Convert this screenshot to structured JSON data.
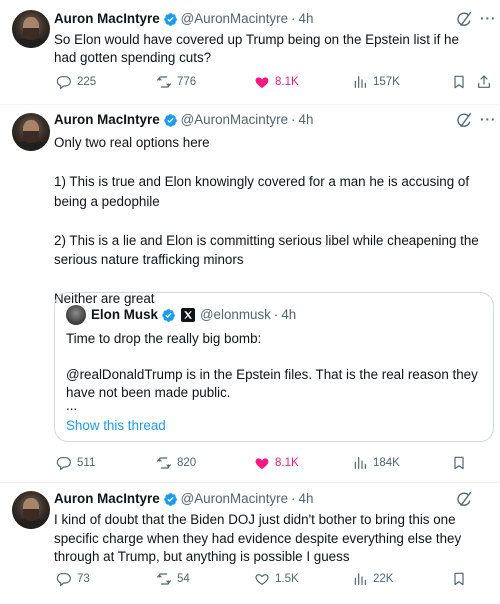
{
  "author": {
    "name": "Auron MacIntyre",
    "handle": "@AuronMacintyre",
    "time": "4h"
  },
  "tweets": [
    {
      "text": "So Elon would have covered up Trump being on the Epstein list if he had gotten spending cuts?",
      "replies": "225",
      "reposts": "776",
      "likes": "8.1K",
      "views": "157K"
    },
    {
      "text": "Only two real options here\n\n1) This is true and Elon knowingly covered for a man he is accusing of being a pedophile\n\n2) This is a lie and Elon is committing serious libel while cheapening the serious nature trafficking minors\n\nNeither are great",
      "replies": "511",
      "reposts": "820",
      "likes": "8.1K",
      "views": "184K"
    },
    {
      "text": "I kind of doubt that the Biden DOJ just didn't bother to bring this one specific charge when they had evidence despite everything else they through at Trump, but anything is possible I guess",
      "replies": "73",
      "reposts": "54",
      "likes": "1.5K",
      "views": "22K"
    }
  ],
  "quote": {
    "name": "Elon Musk",
    "handle": "@elonmusk",
    "time": "4h",
    "text": "Time to drop the really big bomb:\n\n@realDonaldTrump is in the Epstein files. That is the real reason they have not been made public.",
    "ellipsis": "...",
    "show_thread": "Show this thread"
  },
  "colors": {
    "verified": "#1d9bf0",
    "like_active": "#f91880",
    "secondary_text": "#536471",
    "link": "#1d9bf0"
  },
  "icons": [
    "grok-icon",
    "more-icon",
    "reply-icon",
    "repost-icon",
    "like-icon",
    "views-icon",
    "bookmark-icon",
    "share-icon",
    "verified-badge-icon",
    "x-affiliate-icon"
  ]
}
